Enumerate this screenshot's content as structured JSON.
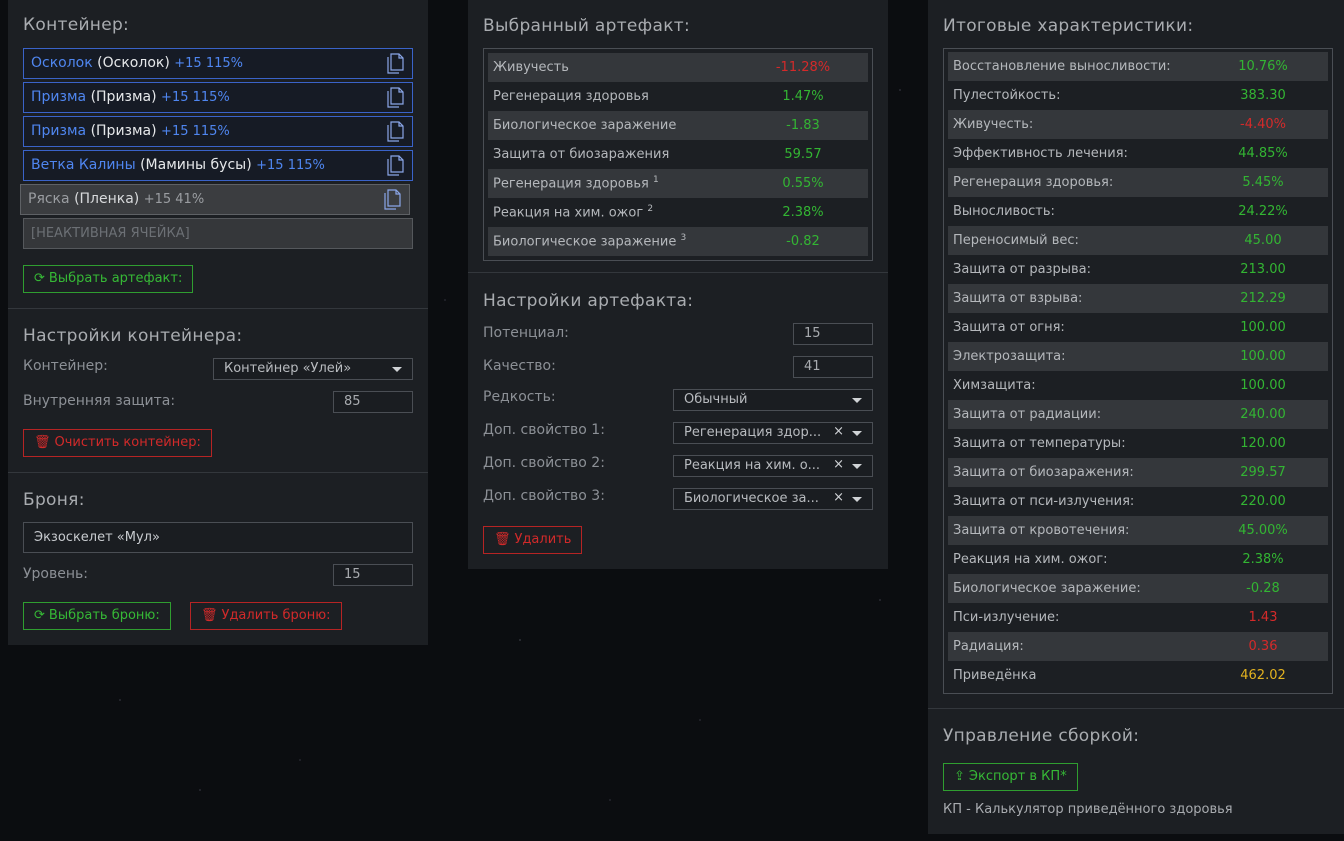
{
  "container_panel": {
    "title": "Контейнер:",
    "slots": [
      {
        "name": "Осколок",
        "orig": "(Осколок)",
        "level": "+15 115%"
      },
      {
        "name": "Призма",
        "orig": "(Призма)",
        "level": "+15 115%"
      },
      {
        "name": "Призма",
        "orig": "(Призма)",
        "level": "+15 115%"
      },
      {
        "name": "Ветка Калины",
        "orig": "(Мамины бусы)",
        "level": "+15 115%"
      },
      {
        "name": "Ряска",
        "orig": "(Пленка)",
        "level": "+15 41%"
      }
    ],
    "inactive_slot": "[НЕАКТИВНАЯ ЯЧЕЙКА]",
    "choose_artifact": "Выбрать артефакт:",
    "settings_title": "Настройки контейнера:",
    "container_label": "Контейнер:",
    "container_value": "Контейнер «Улей»",
    "inner_protection_label": "Внутренняя защита:",
    "inner_protection_value": "85",
    "clear_container": "Очистить контейнер:",
    "armor_title": "Броня:",
    "armor_value": "Экзоскелет «Мул»",
    "level_label": "Уровень:",
    "level_value": "15",
    "choose_armor": "Выбрать броню:",
    "delete_armor": "Удалить броню:"
  },
  "artifact_panel": {
    "title": "Выбранный артефакт:",
    "stats": [
      {
        "label": "Живучесть",
        "sup": "",
        "value": "-11.28%",
        "color": "r"
      },
      {
        "label": "Регенерация здоровья",
        "sup": "",
        "value": "1.47%",
        "color": "g"
      },
      {
        "label": "Биологическое заражение",
        "sup": "",
        "value": "-1.83",
        "color": "g"
      },
      {
        "label": "Защита от биозаражения",
        "sup": "",
        "value": "59.57",
        "color": "g"
      },
      {
        "label": "Регенерация здоровья",
        "sup": "1",
        "value": "0.55%",
        "color": "g"
      },
      {
        "label": "Реакция на хим. ожог",
        "sup": "2",
        "value": "2.38%",
        "color": "g"
      },
      {
        "label": "Биологическое заражение",
        "sup": "3",
        "value": "-0.82",
        "color": "g"
      }
    ],
    "settings_title": "Настройки артефакта:",
    "potential_label": "Потенциал:",
    "potential_value": "15",
    "quality_label": "Качество:",
    "quality_value": "41",
    "rarity_label": "Редкость:",
    "rarity_value": "Обычный",
    "extra1_label": "Доп. свойство 1:",
    "extra1_value": "Регенерация здор...",
    "extra2_label": "Доп. свойство 2:",
    "extra2_value": "Реакция на хим. о...",
    "extra3_label": "Доп. свойство 3:",
    "extra3_value": "Биологическое за...",
    "delete": "Удалить"
  },
  "summary_panel": {
    "title": "Итоговые характеристики:",
    "stats": [
      {
        "label": "Восстановление выносливости:",
        "value": "10.76%",
        "color": "g"
      },
      {
        "label": "Пулестойкость:",
        "value": "383.30",
        "color": "g"
      },
      {
        "label": "Живучесть:",
        "value": "-4.40%",
        "color": "r"
      },
      {
        "label": "Эффективность лечения:",
        "value": "44.85%",
        "color": "g"
      },
      {
        "label": "Регенерация здоровья:",
        "value": "5.45%",
        "color": "g"
      },
      {
        "label": "Выносливость:",
        "value": "24.22%",
        "color": "g"
      },
      {
        "label": "Переносимый вес:",
        "value": "45.00",
        "color": "g"
      },
      {
        "label": "Защита от разрыва:",
        "value": "213.00",
        "color": "g"
      },
      {
        "label": "Защита от взрыва:",
        "value": "212.29",
        "color": "g"
      },
      {
        "label": "Защита от огня:",
        "value": "100.00",
        "color": "g"
      },
      {
        "label": "Электрозащита:",
        "value": "100.00",
        "color": "g"
      },
      {
        "label": "Химзащита:",
        "value": "100.00",
        "color": "g"
      },
      {
        "label": "Защита от радиации:",
        "value": "240.00",
        "color": "g"
      },
      {
        "label": "Защита от температуры:",
        "value": "120.00",
        "color": "g"
      },
      {
        "label": "Защита от биозаражения:",
        "value": "299.57",
        "color": "g"
      },
      {
        "label": "Защита от пси-излучения:",
        "value": "220.00",
        "color": "g"
      },
      {
        "label": "Защита от кровотечения:",
        "value": "45.00%",
        "color": "g"
      },
      {
        "label": "Реакция на хим. ожог:",
        "value": "2.38%",
        "color": "g"
      },
      {
        "label": "Биологическое заражение:",
        "value": "-0.28",
        "color": "g"
      },
      {
        "label": "Пси-излучение:",
        "value": "1.43",
        "color": "r"
      },
      {
        "label": "Радиация:",
        "value": "0.36",
        "color": "r"
      },
      {
        "label": "Приведёнка",
        "value": "462.02",
        "color": "y"
      }
    ],
    "build_title": "Управление сборкой:",
    "export_button": "Экспорт в КП*",
    "footnote": "КП - Калькулятор приведённого здоровья"
  }
}
